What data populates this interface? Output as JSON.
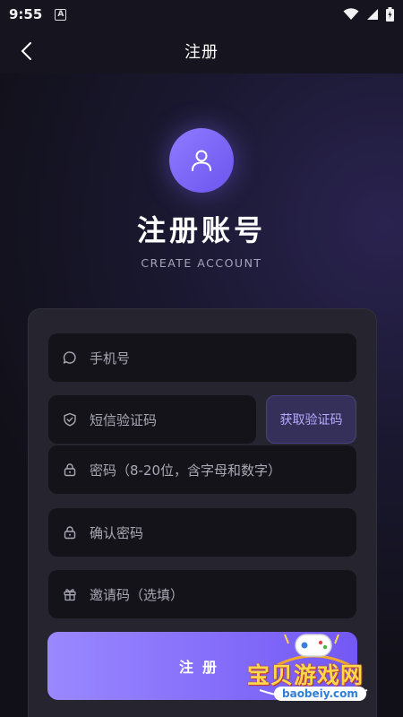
{
  "status_bar": {
    "time": "9:55",
    "notification_letter": "A"
  },
  "header": {
    "title": "注册"
  },
  "hero": {
    "title": "注册账号",
    "subtitle": "CREATE ACCOUNT"
  },
  "form": {
    "phone_placeholder": "手机号",
    "sms_placeholder": "短信验证码",
    "get_code_label": "获取验证码",
    "password_placeholder": "密码（8-20位，含字母和数字）",
    "confirm_placeholder": "确认密码",
    "invite_placeholder": "邀请码（选填）",
    "submit_label": "注册"
  },
  "watermark": {
    "text": "宝贝游戏网",
    "url": "baobeiy.com"
  },
  "colors": {
    "accent": "#7b63f7",
    "accent_light": "#9a88ff",
    "card": "#26252f",
    "field": "#14131a",
    "placeholder": "#a9a8b4"
  },
  "icons": {
    "back": "chevron-left-icon",
    "avatar": "user-icon",
    "phone": "chat-bubble-icon",
    "sms": "shield-check-icon",
    "password": "lock-icon",
    "confirm": "lock-icon",
    "invite": "gift-icon"
  }
}
